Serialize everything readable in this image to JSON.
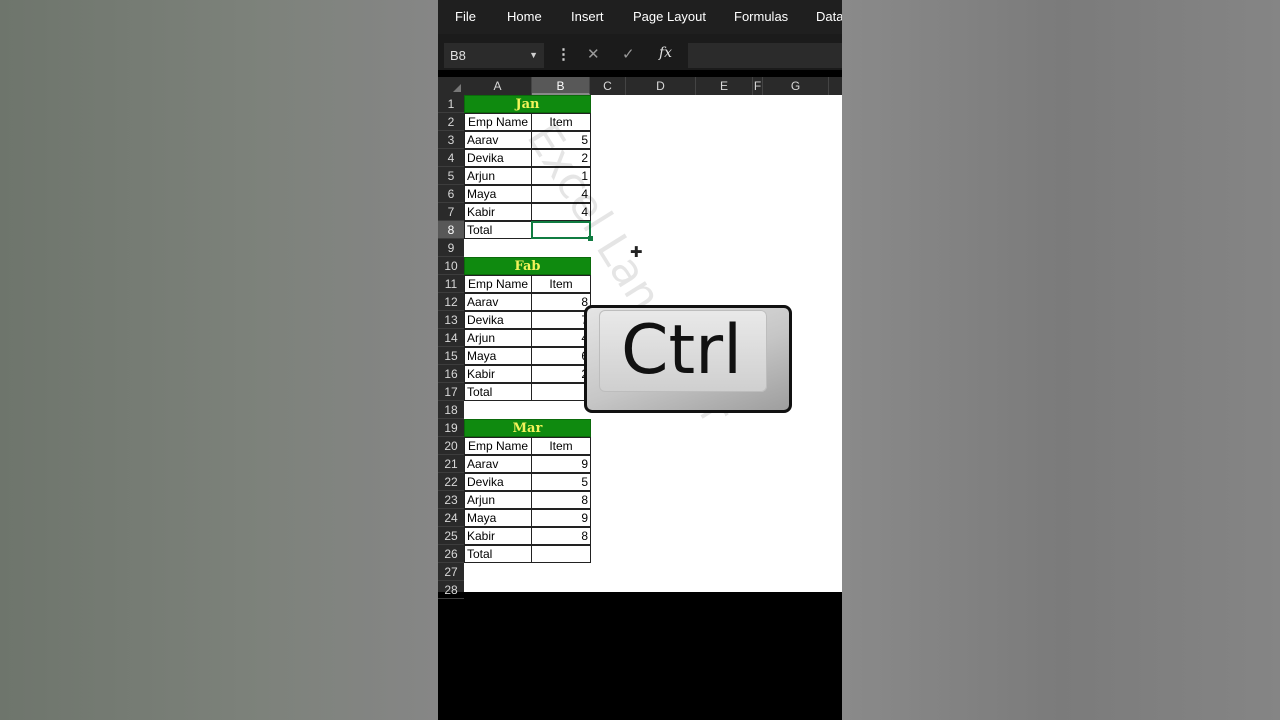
{
  "ribbon": {
    "tabs": [
      "File",
      "Home",
      "Insert",
      "Page Layout",
      "Formulas",
      "Data"
    ]
  },
  "formula_bar": {
    "name_box": "B8",
    "cancel_icon": "close-icon",
    "enter_icon": "check-icon",
    "fx_label": "fx",
    "formula": ""
  },
  "columns": [
    "A",
    "B",
    "C",
    "D",
    "E",
    "F",
    "G"
  ],
  "rows": [
    "1",
    "2",
    "3",
    "4",
    "5",
    "6",
    "7",
    "8",
    "9",
    "10",
    "11",
    "12",
    "13",
    "14",
    "15",
    "16",
    "17",
    "18",
    "19",
    "20",
    "21",
    "22",
    "23",
    "24",
    "25",
    "26",
    "27",
    "28"
  ],
  "tables": [
    {
      "title": "Jan",
      "header": [
        "Emp Name",
        "Item"
      ],
      "rows": [
        [
          "Aarav",
          "5"
        ],
        [
          "Devika",
          "2"
        ],
        [
          "Arjun",
          "1"
        ],
        [
          "Maya",
          "4"
        ],
        [
          "Kabir",
          "4"
        ],
        [
          "Total",
          ""
        ]
      ]
    },
    {
      "title": "Fab",
      "header": [
        "Emp Name",
        "Item"
      ],
      "rows": [
        [
          "Aarav",
          "8"
        ],
        [
          "Devika",
          "7"
        ],
        [
          "Arjun",
          "4"
        ],
        [
          "Maya",
          "6"
        ],
        [
          "Kabir",
          "2"
        ],
        [
          "Total",
          ""
        ]
      ]
    },
    {
      "title": "Mar",
      "header": [
        "Emp Name",
        "Item"
      ],
      "rows": [
        [
          "Aarav",
          "9"
        ],
        [
          "Devika",
          "5"
        ],
        [
          "Arjun",
          "8"
        ],
        [
          "Maya",
          "9"
        ],
        [
          "Kabir",
          "8"
        ],
        [
          "Total",
          ""
        ]
      ]
    }
  ],
  "active_cell": "B8",
  "watermark": "Excel Lane Tour",
  "overlay": {
    "key_label": "Ctrl"
  },
  "colors": {
    "title_fill": "#0f8a0f",
    "title_text": "#f3f35a",
    "selection": "#107c41"
  }
}
